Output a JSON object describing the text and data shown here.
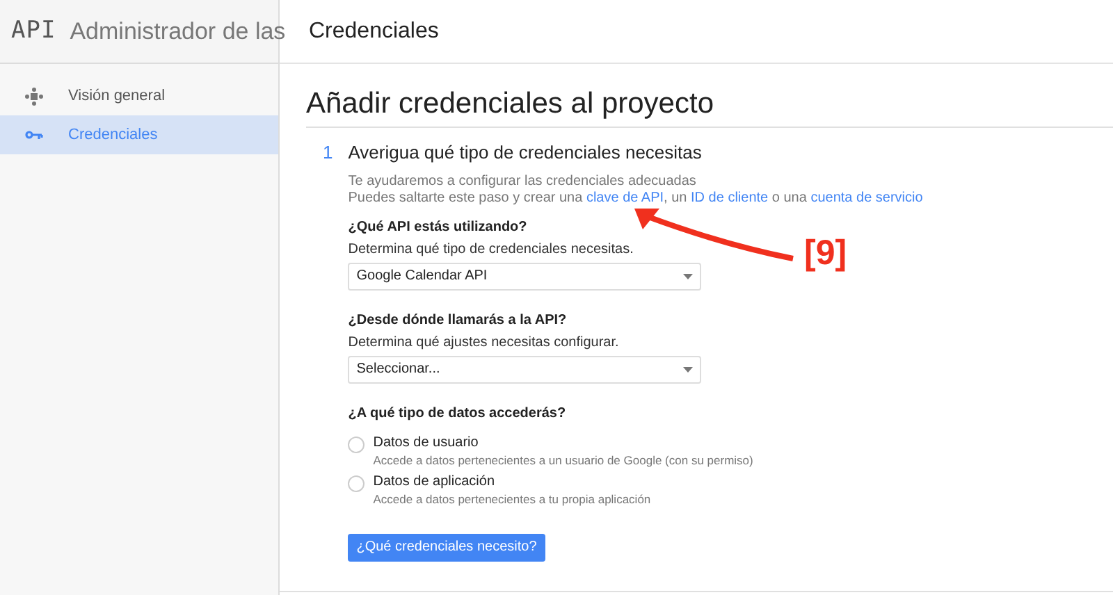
{
  "header": {
    "logo": "API",
    "app_title": "Administrador de las",
    "page_title": "Credenciales"
  },
  "sidebar": {
    "items": [
      {
        "label": "Visión general",
        "selected": false
      },
      {
        "label": "Credenciales",
        "selected": true
      }
    ]
  },
  "main": {
    "heading": "Añadir credenciales al proyecto",
    "step": {
      "number": "1",
      "title": "Averigua qué tipo de credenciales necesitas",
      "intro": "Te ayudaremos a configurar las credenciales adecuadas",
      "shortcut": [
        {
          "kind": "text",
          "text": "Puedes saltarte este paso y crear una "
        },
        {
          "kind": "link",
          "text": "clave de API"
        },
        {
          "kind": "text",
          "text": ", un "
        },
        {
          "kind": "link",
          "text": "ID de cliente"
        },
        {
          "kind": "text",
          "text": " o una "
        },
        {
          "kind": "link",
          "text": "cuenta de servicio"
        }
      ],
      "questions": [
        {
          "kind": "select",
          "title": "¿Qué API estás utilizando?",
          "hint": "Determina qué tipo de credenciales necesitas.",
          "value": "Google Calendar API"
        },
        {
          "kind": "select",
          "title": "¿Desde dónde llamarás a la API?",
          "hint": "Determina qué ajustes necesitas configurar.",
          "value": "Seleccionar..."
        },
        {
          "kind": "radio",
          "title": "¿A qué tipo de datos accederás?",
          "options": [
            {
              "label": "Datos de usuario",
              "description": "Accede a datos pertenecientes a un usuario de Google (con su permiso)",
              "selected": false
            },
            {
              "label": "Datos de aplicación",
              "description": "Accede a datos pertenecientes a tu propia aplicación",
              "selected": false
            }
          ]
        }
      ],
      "button": "¿Qué credenciales necesito?"
    }
  },
  "annotation": {
    "label": "[9]"
  }
}
